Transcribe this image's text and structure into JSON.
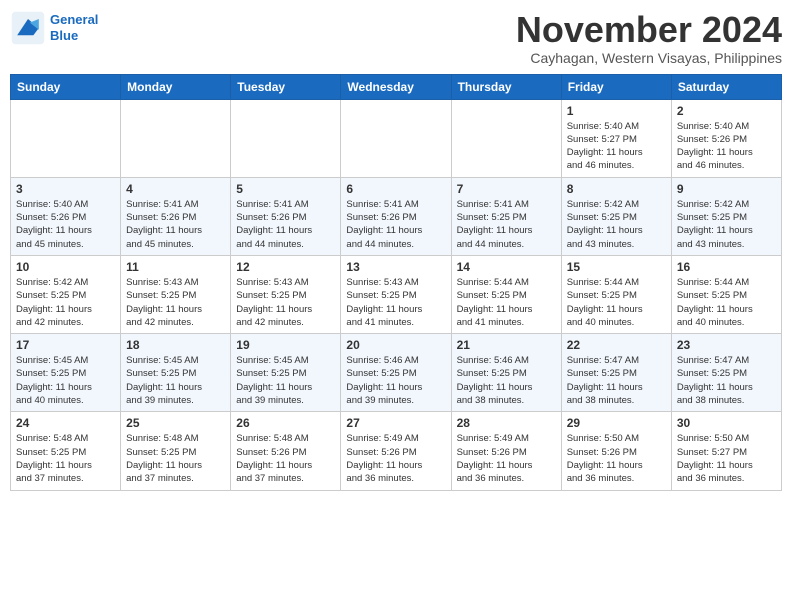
{
  "logo": {
    "line1": "General",
    "line2": "Blue"
  },
  "title": "November 2024",
  "subtitle": "Cayhagan, Western Visayas, Philippines",
  "weekdays": [
    "Sunday",
    "Monday",
    "Tuesday",
    "Wednesday",
    "Thursday",
    "Friday",
    "Saturday"
  ],
  "weeks": [
    [
      {
        "day": "",
        "info": ""
      },
      {
        "day": "",
        "info": ""
      },
      {
        "day": "",
        "info": ""
      },
      {
        "day": "",
        "info": ""
      },
      {
        "day": "",
        "info": ""
      },
      {
        "day": "1",
        "info": "Sunrise: 5:40 AM\nSunset: 5:27 PM\nDaylight: 11 hours\nand 46 minutes."
      },
      {
        "day": "2",
        "info": "Sunrise: 5:40 AM\nSunset: 5:26 PM\nDaylight: 11 hours\nand 46 minutes."
      }
    ],
    [
      {
        "day": "3",
        "info": "Sunrise: 5:40 AM\nSunset: 5:26 PM\nDaylight: 11 hours\nand 45 minutes."
      },
      {
        "day": "4",
        "info": "Sunrise: 5:41 AM\nSunset: 5:26 PM\nDaylight: 11 hours\nand 45 minutes."
      },
      {
        "day": "5",
        "info": "Sunrise: 5:41 AM\nSunset: 5:26 PM\nDaylight: 11 hours\nand 44 minutes."
      },
      {
        "day": "6",
        "info": "Sunrise: 5:41 AM\nSunset: 5:26 PM\nDaylight: 11 hours\nand 44 minutes."
      },
      {
        "day": "7",
        "info": "Sunrise: 5:41 AM\nSunset: 5:25 PM\nDaylight: 11 hours\nand 44 minutes."
      },
      {
        "day": "8",
        "info": "Sunrise: 5:42 AM\nSunset: 5:25 PM\nDaylight: 11 hours\nand 43 minutes."
      },
      {
        "day": "9",
        "info": "Sunrise: 5:42 AM\nSunset: 5:25 PM\nDaylight: 11 hours\nand 43 minutes."
      }
    ],
    [
      {
        "day": "10",
        "info": "Sunrise: 5:42 AM\nSunset: 5:25 PM\nDaylight: 11 hours\nand 42 minutes."
      },
      {
        "day": "11",
        "info": "Sunrise: 5:43 AM\nSunset: 5:25 PM\nDaylight: 11 hours\nand 42 minutes."
      },
      {
        "day": "12",
        "info": "Sunrise: 5:43 AM\nSunset: 5:25 PM\nDaylight: 11 hours\nand 42 minutes."
      },
      {
        "day": "13",
        "info": "Sunrise: 5:43 AM\nSunset: 5:25 PM\nDaylight: 11 hours\nand 41 minutes."
      },
      {
        "day": "14",
        "info": "Sunrise: 5:44 AM\nSunset: 5:25 PM\nDaylight: 11 hours\nand 41 minutes."
      },
      {
        "day": "15",
        "info": "Sunrise: 5:44 AM\nSunset: 5:25 PM\nDaylight: 11 hours\nand 40 minutes."
      },
      {
        "day": "16",
        "info": "Sunrise: 5:44 AM\nSunset: 5:25 PM\nDaylight: 11 hours\nand 40 minutes."
      }
    ],
    [
      {
        "day": "17",
        "info": "Sunrise: 5:45 AM\nSunset: 5:25 PM\nDaylight: 11 hours\nand 40 minutes."
      },
      {
        "day": "18",
        "info": "Sunrise: 5:45 AM\nSunset: 5:25 PM\nDaylight: 11 hours\nand 39 minutes."
      },
      {
        "day": "19",
        "info": "Sunrise: 5:45 AM\nSunset: 5:25 PM\nDaylight: 11 hours\nand 39 minutes."
      },
      {
        "day": "20",
        "info": "Sunrise: 5:46 AM\nSunset: 5:25 PM\nDaylight: 11 hours\nand 39 minutes."
      },
      {
        "day": "21",
        "info": "Sunrise: 5:46 AM\nSunset: 5:25 PM\nDaylight: 11 hours\nand 38 minutes."
      },
      {
        "day": "22",
        "info": "Sunrise: 5:47 AM\nSunset: 5:25 PM\nDaylight: 11 hours\nand 38 minutes."
      },
      {
        "day": "23",
        "info": "Sunrise: 5:47 AM\nSunset: 5:25 PM\nDaylight: 11 hours\nand 38 minutes."
      }
    ],
    [
      {
        "day": "24",
        "info": "Sunrise: 5:48 AM\nSunset: 5:25 PM\nDaylight: 11 hours\nand 37 minutes."
      },
      {
        "day": "25",
        "info": "Sunrise: 5:48 AM\nSunset: 5:25 PM\nDaylight: 11 hours\nand 37 minutes."
      },
      {
        "day": "26",
        "info": "Sunrise: 5:48 AM\nSunset: 5:26 PM\nDaylight: 11 hours\nand 37 minutes."
      },
      {
        "day": "27",
        "info": "Sunrise: 5:49 AM\nSunset: 5:26 PM\nDaylight: 11 hours\nand 36 minutes."
      },
      {
        "day": "28",
        "info": "Sunrise: 5:49 AM\nSunset: 5:26 PM\nDaylight: 11 hours\nand 36 minutes."
      },
      {
        "day": "29",
        "info": "Sunrise: 5:50 AM\nSunset: 5:26 PM\nDaylight: 11 hours\nand 36 minutes."
      },
      {
        "day": "30",
        "info": "Sunrise: 5:50 AM\nSunset: 5:27 PM\nDaylight: 11 hours\nand 36 minutes."
      }
    ]
  ]
}
